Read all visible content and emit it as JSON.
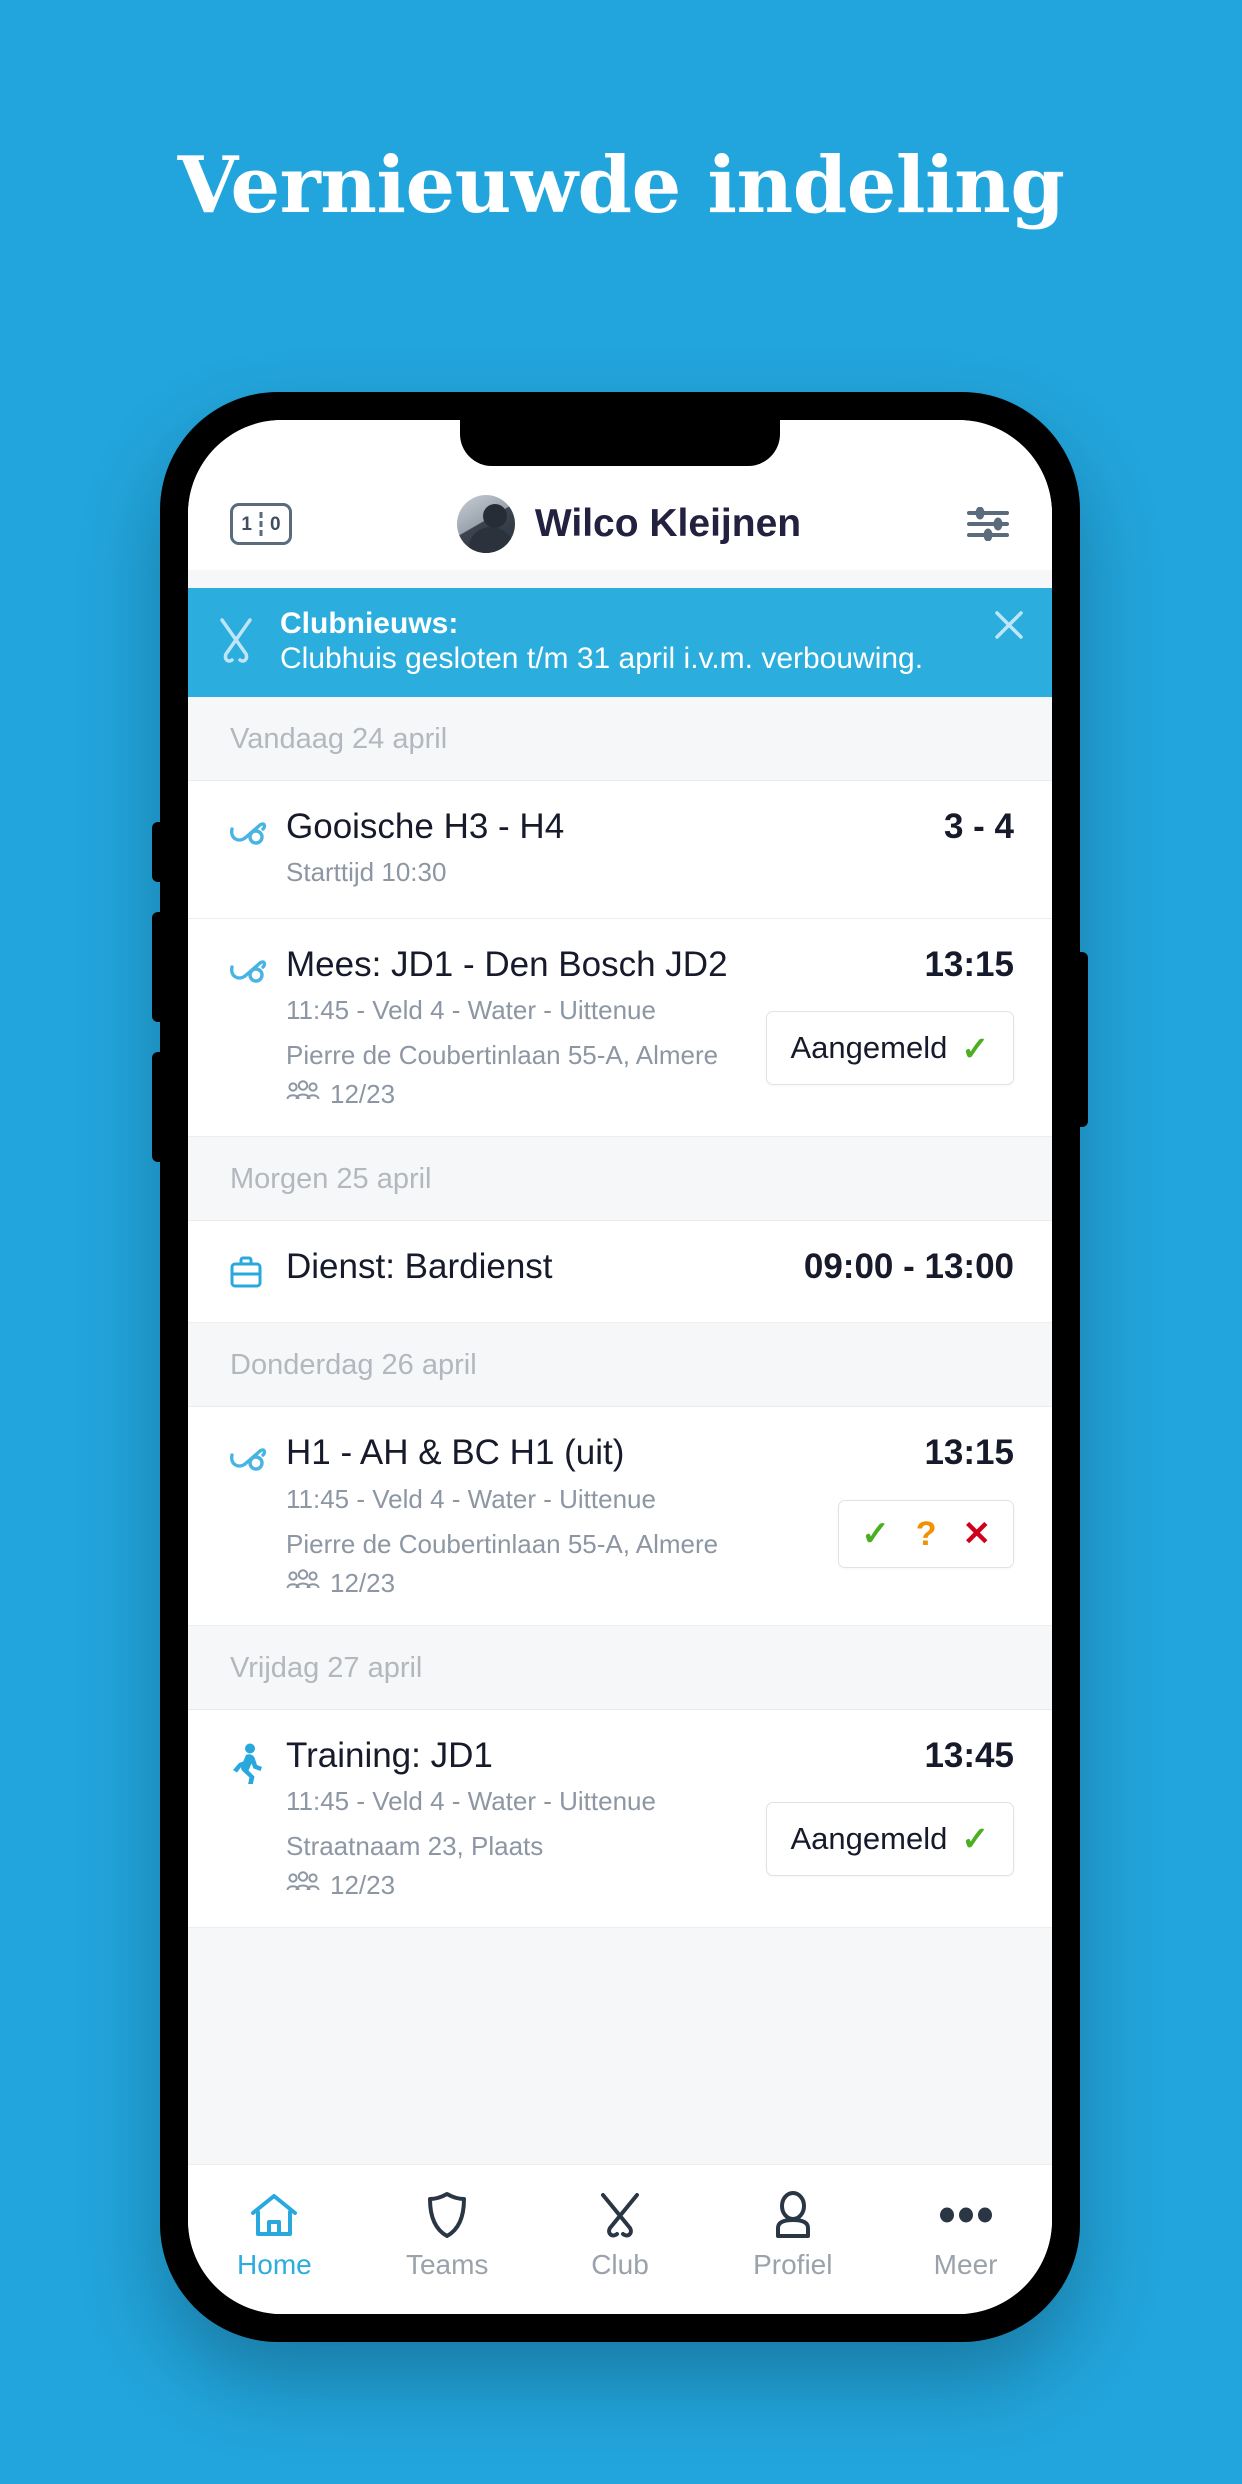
{
  "page": {
    "headline": "Vernieuwde indeling",
    "background_color": "#22a5dc",
    "accent_color": "#2badde"
  },
  "app_header": {
    "scoreboard_icon": "scoreboard-icon",
    "score_left": "1",
    "score_right": "0",
    "avatar": "user-avatar",
    "user_name": "Wilco Kleijnen",
    "filter_icon": "sliders-icon"
  },
  "banner": {
    "icon": "crossed-hockey-sticks-icon",
    "title": "Clubnieuws:",
    "message": "Clubhuis gesloten t/m 31 april i.v.m. verbouwing.",
    "close_icon": "close-icon",
    "background_color": "#2badde"
  },
  "agenda": [
    {
      "day_label": "Vandaag 24 april",
      "items": [
        {
          "icon": "hockey-stick-icon",
          "title": "Gooische H3 - H4",
          "sub1": "Starttijd 10:30",
          "sub2": "",
          "attendance": "",
          "time": "3 - 4",
          "action": "none"
        },
        {
          "icon": "hockey-stick-icon",
          "title": "Mees: JD1 - Den Bosch JD2",
          "sub1": "11:45 - Veld 4 - Water - Uittenue",
          "sub2": "Pierre de Coubertinlaan 55-A, Almere",
          "attendance": "12/23",
          "time": "13:15",
          "action": "aangemeld",
          "action_label": "Aangemeld"
        }
      ]
    },
    {
      "day_label": "Morgen 25 april",
      "items": [
        {
          "icon": "briefcase-icon",
          "title": "Dienst: Bardienst",
          "sub1": "",
          "sub2": "",
          "attendance": "",
          "time": "09:00 - 13:00",
          "action": "none"
        }
      ]
    },
    {
      "day_label": "Donderdag 26 april",
      "items": [
        {
          "icon": "hockey-stick-icon",
          "title": "H1 - AH & BC H1 (uit)",
          "sub1": "11:45 - Veld 4 - Water - Uittenue",
          "sub2": "Pierre de Coubertinlaan 55-A, Almere",
          "attendance": "12/23",
          "time": "13:15",
          "action": "choice",
          "choice_yes": "✓",
          "choice_maybe": "?",
          "choice_no": "✕"
        }
      ]
    },
    {
      "day_label": "Vrijdag 27 april",
      "items": [
        {
          "icon": "running-person-icon",
          "title": "Training: JD1",
          "sub1": "11:45 - Veld 4 - Water - Uittenue",
          "sub2": "Straatnaam 23, Plaats",
          "attendance": "12/23",
          "time": "13:45",
          "action": "aangemeld",
          "action_label": "Aangemeld"
        }
      ]
    }
  ],
  "bottom_nav": {
    "items": [
      {
        "icon": "home-icon",
        "label": "Home",
        "active": true
      },
      {
        "icon": "shield-icon",
        "label": "Teams",
        "active": false
      },
      {
        "icon": "crossed-hockey-sticks-icon",
        "label": "Club",
        "active": false
      },
      {
        "icon": "person-icon",
        "label": "Profiel",
        "active": false
      },
      {
        "icon": "ellipsis-icon",
        "label": "Meer",
        "active": false
      }
    ]
  }
}
